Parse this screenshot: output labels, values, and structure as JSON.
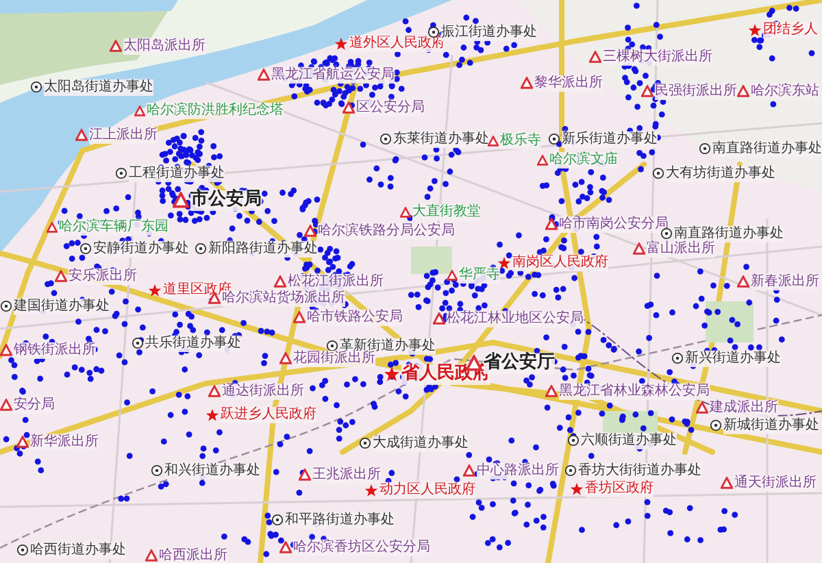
{
  "map": {
    "labels": [
      {
        "text": "太阳岛派出所",
        "kind": "police"
      },
      {
        "text": "太阳岛街道办事处",
        "kind": "office"
      },
      {
        "text": "哈尔滨防洪胜利纪念塔",
        "kind": "poi"
      },
      {
        "text": "江上派出所",
        "kind": "police"
      },
      {
        "text": "工程街道办事处",
        "kind": "office"
      },
      {
        "text": "市公安局",
        "kind": "police_major"
      },
      {
        "text": "哈尔滨车辆厂东园",
        "kind": "poi"
      },
      {
        "text": "安静街道办事处",
        "kind": "office"
      },
      {
        "text": "新阳路街道办事处",
        "kind": "office"
      },
      {
        "text": "安乐派出所",
        "kind": "police"
      },
      {
        "text": "道里区政府",
        "kind": "gov"
      },
      {
        "text": "哈尔滨站货场派出所",
        "kind": "police"
      },
      {
        "text": "建国街道办事处",
        "kind": "office"
      },
      {
        "text": "共乐街道办事处",
        "kind": "office"
      },
      {
        "text": "钢铁街派出所",
        "kind": "police"
      },
      {
        "text": "安分局",
        "kind": "police"
      },
      {
        "text": "通达街派出所",
        "kind": "police"
      },
      {
        "text": "跃进乡人民政府",
        "kind": "gov"
      },
      {
        "text": "新华派出所",
        "kind": "police"
      },
      {
        "text": "和兴街道办事处",
        "kind": "office"
      },
      {
        "text": "哈西街道办事处",
        "kind": "office"
      },
      {
        "text": "哈西派出所",
        "kind": "police"
      },
      {
        "text": "道外区人民政府",
        "kind": "gov"
      },
      {
        "text": "振江街道办事处",
        "kind": "office"
      },
      {
        "text": "黑龙江省航运公安局",
        "kind": "police"
      },
      {
        "text": "区公安分局",
        "kind": "police"
      },
      {
        "text": "东莱街道办事处",
        "kind": "office"
      },
      {
        "text": "极乐寺",
        "kind": "poi"
      },
      {
        "text": "黎华派出所",
        "kind": "police"
      },
      {
        "text": "三棵树大街派出所",
        "kind": "police"
      },
      {
        "text": "民强街派出所",
        "kind": "police"
      },
      {
        "text": "团结乡人",
        "kind": "gov"
      },
      {
        "text": "哈尔滨东站",
        "kind": "police"
      },
      {
        "text": "新乐街道办事处",
        "kind": "office"
      },
      {
        "text": "哈尔滨文庙",
        "kind": "poi"
      },
      {
        "text": "南直路街道办事处",
        "kind": "office"
      },
      {
        "text": "大有坊街道办事处",
        "kind": "office"
      },
      {
        "text": "大直街教堂",
        "kind": "poi"
      },
      {
        "text": "哈尔滨铁路分局公安局",
        "kind": "police"
      },
      {
        "text": "哈市南岗公安分局",
        "kind": "police"
      },
      {
        "text": "南岗区人民政府",
        "kind": "gov"
      },
      {
        "text": "南直路街道办事处",
        "kind": "office"
      },
      {
        "text": "富山派出所",
        "kind": "police"
      },
      {
        "text": "新春派出所",
        "kind": "police"
      },
      {
        "text": "华严寺",
        "kind": "poi"
      },
      {
        "text": "松花江街派出所",
        "kind": "police"
      },
      {
        "text": "哈市铁路公安局",
        "kind": "police"
      },
      {
        "text": "松花江林业地区公安局",
        "kind": "police"
      },
      {
        "text": "革新街道办事处",
        "kind": "office"
      },
      {
        "text": "花园街派出所",
        "kind": "police"
      },
      {
        "text": "省人民政府",
        "kind": "gov_major"
      },
      {
        "text": "省公安厅",
        "kind": "police_major"
      },
      {
        "text": "新兴街道办事处",
        "kind": "office"
      },
      {
        "text": "黑龙江省林业森林公安局",
        "kind": "police"
      },
      {
        "text": "建成派出所",
        "kind": "police"
      },
      {
        "text": "新城街道办事处",
        "kind": "office"
      },
      {
        "text": "大成街道办事处",
        "kind": "office"
      },
      {
        "text": "六顺街道办事处",
        "kind": "office"
      },
      {
        "text": "王兆派出所",
        "kind": "police"
      },
      {
        "text": "中心路派出所",
        "kind": "police"
      },
      {
        "text": "香坊大街街道办事处",
        "kind": "office"
      },
      {
        "text": "动力区人民政府",
        "kind": "gov"
      },
      {
        "text": "香坊区政府",
        "kind": "gov"
      },
      {
        "text": "通天街派出所",
        "kind": "police"
      },
      {
        "text": "和平路街道办事处",
        "kind": "office"
      },
      {
        "text": "哈尔滨香坊区公安分局",
        "kind": "police"
      }
    ]
  }
}
